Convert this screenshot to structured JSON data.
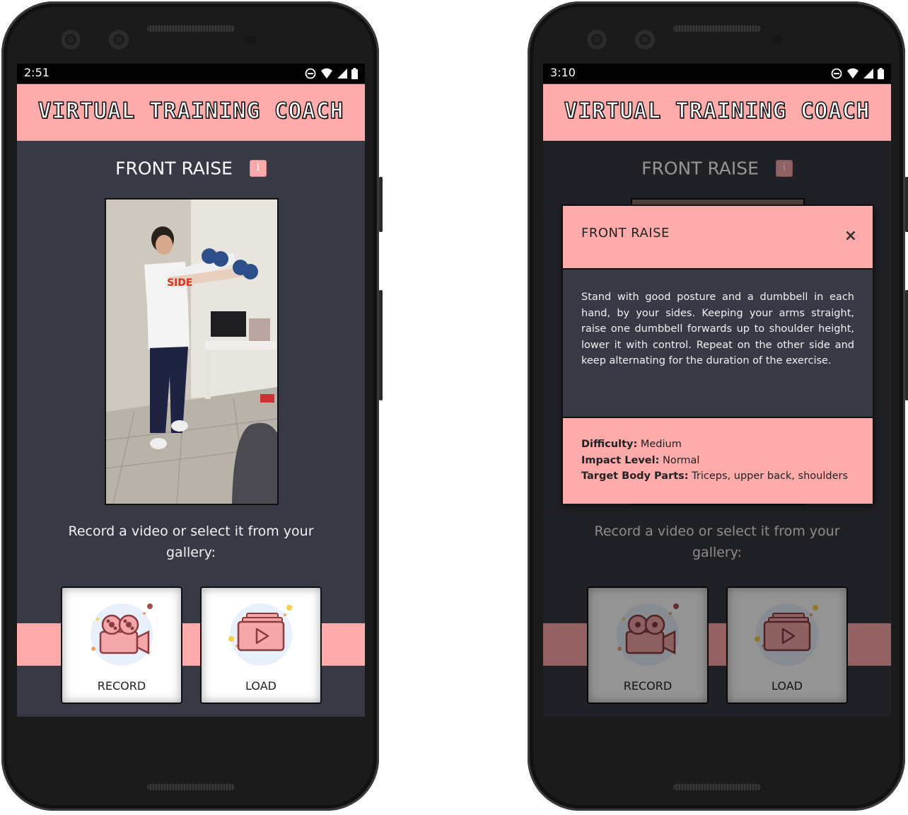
{
  "phones": [
    {
      "status": {
        "time": "2:51"
      },
      "app_title": "VIRTUAL TRAINING COACH",
      "exercise_title": "FRONT RAISE",
      "prompt": "Record a video or select it from your gallery:",
      "buttons": {
        "record": "RECORD",
        "load": "LOAD"
      }
    },
    {
      "status": {
        "time": "3:10"
      },
      "app_title": "VIRTUAL TRAINING COACH",
      "exercise_title": "FRONT RAISE",
      "prompt": "Record a video or select it from your gallery:",
      "buttons": {
        "record": "RECORD",
        "load": "LOAD"
      },
      "modal": {
        "title": "FRONT RAISE",
        "close_icon": "×",
        "description": "Stand with good posture and a dumbbell in each hand, by your sides. Keeping your arms straight, raise one dumbbell forwards up to shoulder height, lower it with control. Repeat on the other side and keep alternating for the duration of the exercise.",
        "difficulty_label": "Difficulty:",
        "difficulty": " Medium",
        "impact_label": "Impact Level:",
        "impact": " Normal",
        "target_label": "Target Body Parts:",
        "target": " Triceps, upper back, shoulders"
      }
    }
  ],
  "colors": {
    "accent_pink": "#ffaaab",
    "screen_bg": "#373a44",
    "icon_accent": "#c96a6d"
  },
  "icons": [
    "dnd-icon",
    "wifi-icon",
    "signal-icon",
    "battery-icon",
    "info-icon",
    "video-camera-icon",
    "play-video-icon",
    "close-icon",
    "back-icon",
    "home-icon",
    "recents-icon"
  ]
}
